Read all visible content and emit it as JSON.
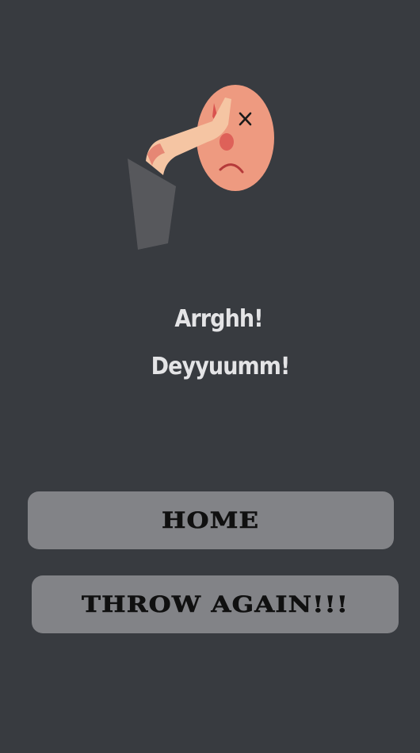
{
  "screen": {
    "background_color": "#383b40"
  },
  "illustration": {
    "description_icon": "facepalm-icon",
    "skin_color": "#e9967a",
    "arm_color": "#f5c5a3",
    "sleeve_color": "#57585c"
  },
  "message": {
    "line1": "Arrghh!",
    "line2": "Deyyuumm!"
  },
  "buttons": {
    "home_label": "HOME",
    "throw_again_label": "THROW AGAIN!!!",
    "color": "#828387"
  }
}
